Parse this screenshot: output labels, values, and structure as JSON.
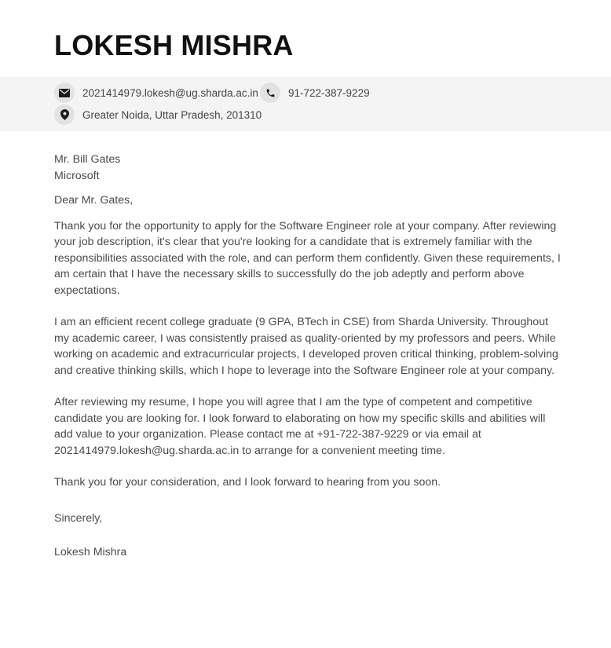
{
  "header": {
    "name": "LOKESH MISHRA"
  },
  "contact": {
    "email": "2021414979.lokesh@ug.sharda.ac.in",
    "phone": "91-722-387-9229",
    "address": "Greater Noida, Uttar Pradesh, 201310",
    "icons": {
      "email": "envelope-icon",
      "phone": "phone-icon",
      "address": "location-pin-icon"
    }
  },
  "letter": {
    "recipient_name": "Mr. Bill Gates",
    "recipient_company": "Microsoft",
    "salutation": "Dear Mr. Gates,",
    "paragraphs": [
      "Thank you for the opportunity to apply for the Software Engineer role at your company. After reviewing your job description, it's clear that you're looking for a candidate that is extremely familiar with the responsibilities associated with the role, and can perform them confidently. Given these requirements, I am certain that I have the necessary skills to successfully do the job adeptly and perform above expectations.",
      "I am an efficient recent college graduate (9 GPA, BTech in CSE) from Sharda University. Throughout my academic career, I was consistently praised as quality-oriented by my professors and peers. While working on academic and extracurricular projects, I developed proven critical thinking, problem-solving and creative thinking skills, which I hope to leverage into the Software Engineer role at your company.",
      "After reviewing my resume, I hope you will agree that I am the type of competent and competitive candidate you are looking for. I look forward to elaborating on how my specific skills and abilities will add value to your organization. Please contact me at +91-722-387-9229 or via email at 2021414979.lokesh@ug.sharda.ac.in to arrange for a convenient meeting time."
    ],
    "closing_line": "Thank you for your consideration, and I look forward to hearing from you soon.",
    "signoff": "Sincerely,",
    "signature": "Lokesh Mishra"
  },
  "colors": {
    "name_text": "#111111",
    "body_text": "#4a4a4a",
    "contact_bar_bg": "#f4f4f4",
    "icon_circle_bg": "#e2e2e2",
    "icon_fill": "#1a1a1a"
  }
}
